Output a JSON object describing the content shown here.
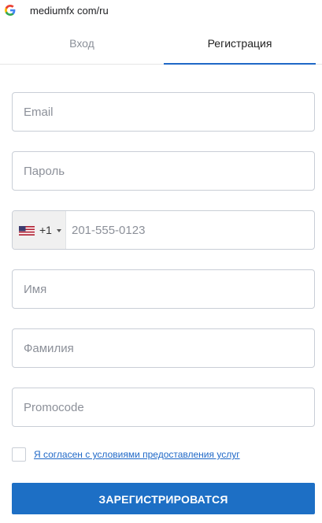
{
  "browser": {
    "url": "mediumfx com/ru",
    "favicon_icon": "google-g-icon"
  },
  "tabs": [
    {
      "label": "Вход",
      "active": false
    },
    {
      "label": "Регистрация",
      "active": true
    }
  ],
  "form": {
    "email_placeholder": "Email",
    "password_placeholder": "Пароль",
    "phone": {
      "country_flag_icon": "us-flag-icon",
      "dial_code": "+1",
      "placeholder": "201-555-0123"
    },
    "first_name_placeholder": "Имя",
    "last_name_placeholder": "Фамилия",
    "promocode_placeholder": "Promocode",
    "agree_text": "Я согласен с условиями предоставления услуг",
    "submit_label": "ЗАРЕГИСТРИРОВАТСЯ"
  },
  "colors": {
    "accent": "#1d6fc5",
    "tab_underline": "#1f68c7",
    "link": "#1f68c7",
    "field_border": "#c9ced6"
  }
}
